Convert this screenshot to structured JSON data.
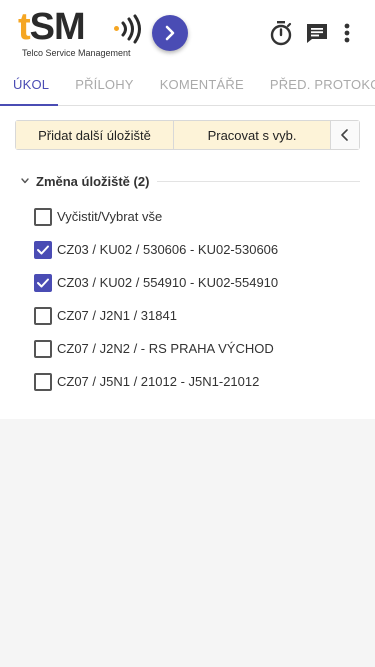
{
  "brand": {
    "letter_t": "t",
    "letters_sm": "SM",
    "tagline": "Telco Service Management",
    "accent_color": "#f5a623",
    "primary_color": "#4a4cb4"
  },
  "header": {
    "forward_icon": "chevron-right-icon",
    "timer_icon": "stopwatch-icon",
    "chat_icon": "chat-icon",
    "more_icon": "more-vert-icon"
  },
  "tabs": [
    {
      "label": "ÚKOL",
      "active": true
    },
    {
      "label": "PŘÍLOHY",
      "active": false
    },
    {
      "label": "KOMENTÁŘE",
      "active": false
    },
    {
      "label": "PŘED. PROTOKOL",
      "active": false
    }
  ],
  "actions": {
    "add_storage": "Přidat další úložiště",
    "work_with_selected": "Pracovat s vyb.",
    "collapse_icon": "chevron-left-icon"
  },
  "group": {
    "title": "Změna úložiště (2)",
    "expanded": true
  },
  "items": [
    {
      "label": "Vyčistit/Vybrat vše",
      "checked": false
    },
    {
      "label": "CZ03 / KU02 / 530606 - KU02-530606",
      "checked": true
    },
    {
      "label": "CZ03 / KU02 / 554910 - KU02-554910",
      "checked": true
    },
    {
      "label": "CZ07 / J2N1 / 31841",
      "checked": false
    },
    {
      "label": "CZ07 / J2N2 / - RS PRAHA VÝCHOD",
      "checked": false
    },
    {
      "label": "CZ07 / J5N1 / 21012 - J5N1-21012",
      "checked": false
    }
  ]
}
